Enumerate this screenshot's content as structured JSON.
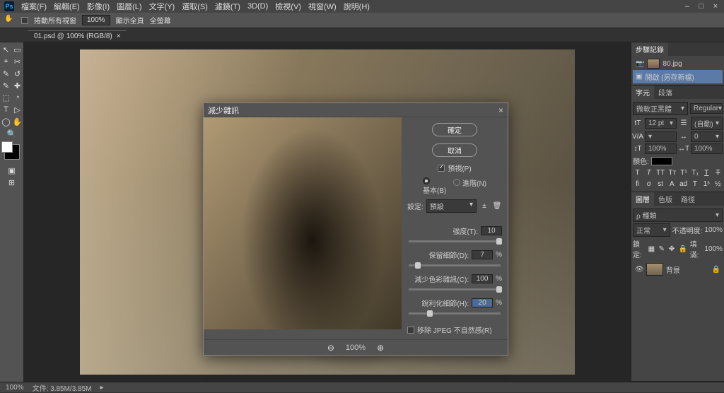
{
  "app": {
    "ps_badge": "Ps"
  },
  "menu": {
    "items": [
      "檔案(F)",
      "編輯(E)",
      "影像(I)",
      "圖層(L)",
      "文字(Y)",
      "選取(S)",
      "濾鏡(T)",
      "3D(D)",
      "檢視(V)",
      "視窗(W)",
      "說明(H)"
    ],
    "win_min": "–",
    "win_max": "□",
    "win_close": "×"
  },
  "options": {
    "scroll_windows": "捲動所有視窗",
    "zoom_value": "100%",
    "fit_screen": "顯示全頁",
    "fill_screen": "全螢幕"
  },
  "tab": {
    "label": "01.psd @ 100% (RGB/8)",
    "close": "×"
  },
  "toolbar": {
    "tools": [
      "↖",
      "▭",
      "⌖",
      "✂",
      "✎",
      "↺",
      "✎",
      "✚",
      "⬚",
      "◔",
      "T",
      "▷",
      "◯",
      "✋",
      "🔍"
    ]
  },
  "panels": {
    "history": {
      "tab": "步驟記錄",
      "item0": "80.jpg",
      "item1": "開啟 (另存新檔)"
    },
    "character": {
      "tabs": [
        "字元",
        "段落"
      ],
      "font_family": "微軟正黑體",
      "font_style": "Regular",
      "size_icon": "tT",
      "size_value": "12 pt",
      "leading_value": "(自動)",
      "va_label": "V/A",
      "tracking_value": "0",
      "vscale": "100%",
      "hscale": "100%",
      "color_label": "顏色:"
    },
    "layers": {
      "tabs": [
        "圖層",
        "色版",
        "路徑"
      ],
      "search_label": "ρ 種類",
      "blend_mode": "正常",
      "opacity_label": "不透明度:",
      "opacity_value": "100%",
      "lock_label": "鎖定:",
      "fill_label": "填滿:",
      "fill_value": "100%",
      "layer_name": "背景",
      "lock_icon": "🔒"
    }
  },
  "dialog": {
    "title": "減少雜訊",
    "close": "×",
    "btn_ok": "確定",
    "btn_cancel": "取消",
    "preview_label": "預視(P)",
    "radio_basic": "基本(B)",
    "radio_advanced": "進階(N)",
    "settings_label": "設定:",
    "settings_value": "預設",
    "strength_label": "強度(T):",
    "strength_value": "10",
    "preserve_label": "保留細節(D):",
    "preserve_value": "7",
    "percent": "%",
    "reduce_color_label": "減少色彩雜訊(C):",
    "reduce_color_value": "100",
    "sharpen_label": "銳利化細節(H):",
    "sharpen_value": "20",
    "remove_jpeg_label": "移除 JPEG 不自然感(R)",
    "zoom_out": "⊖",
    "zoom_value": "100%",
    "zoom_in": "⊕"
  },
  "status": {
    "zoom": "100%",
    "doc_size": "文件: 3.85M/3.85M"
  }
}
